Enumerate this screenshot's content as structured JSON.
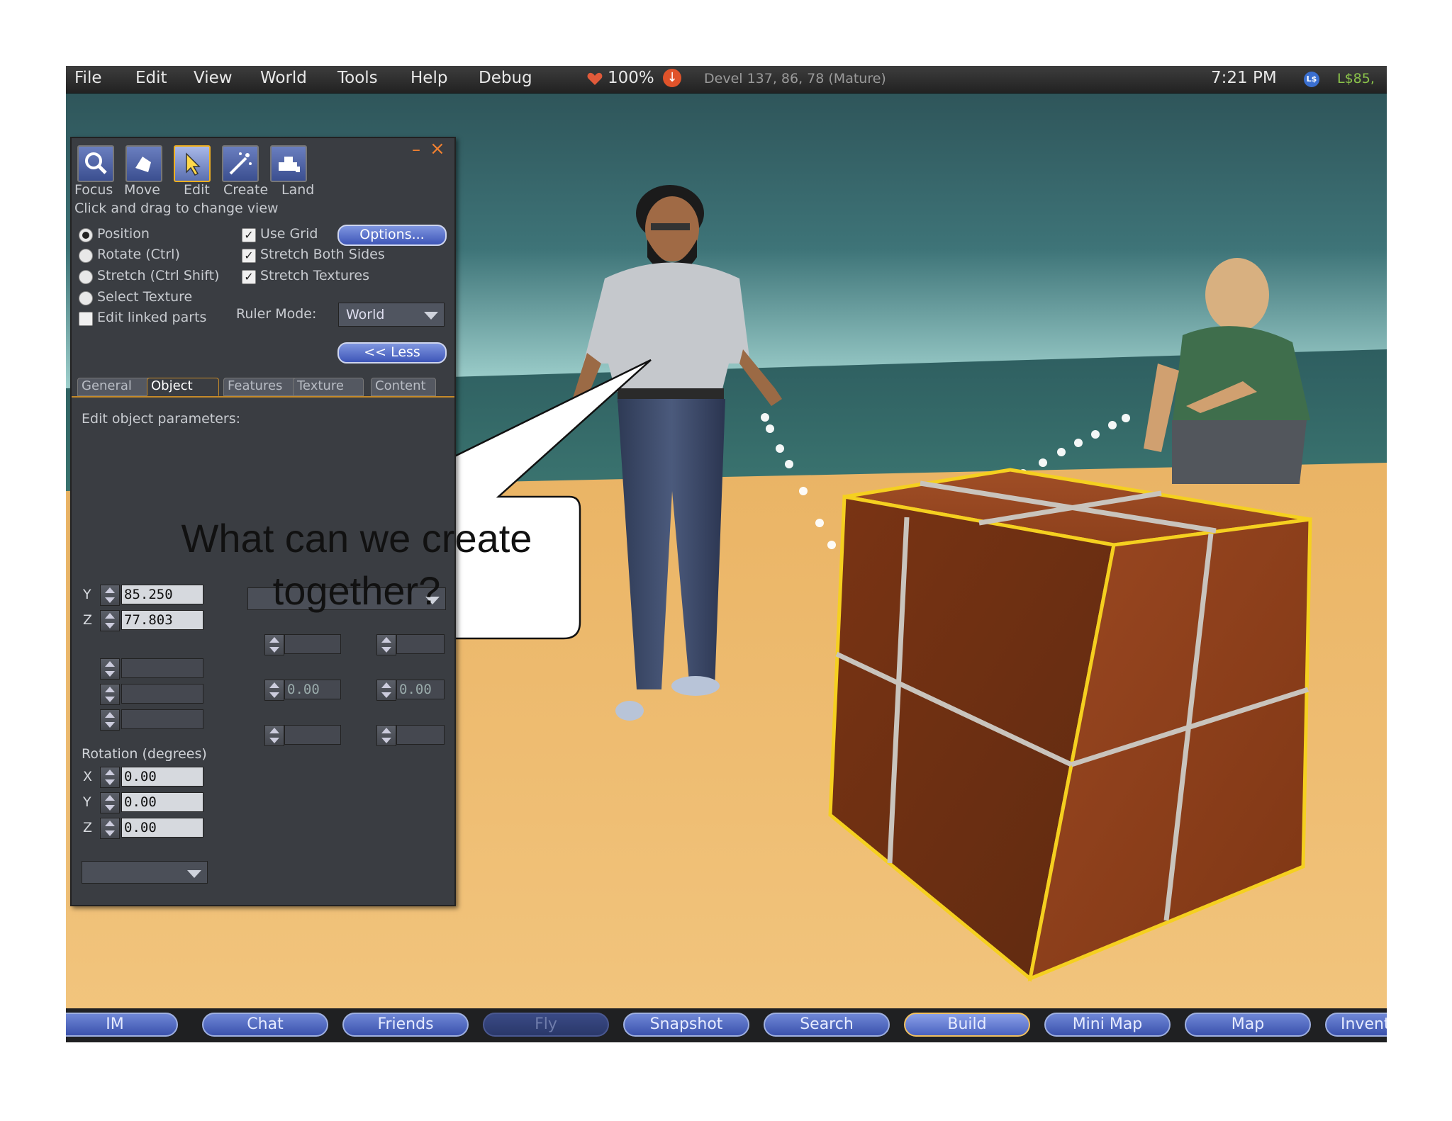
{
  "menu": {
    "items": [
      "File",
      "Edit",
      "View",
      "World",
      "Tools",
      "Help",
      "Debug"
    ],
    "health": "100%",
    "location": "Devel 137, 86, 78 (Mature)",
    "clock": "7:21 PM",
    "balance": "L$85,"
  },
  "build_panel": {
    "tools": [
      {
        "label": "Focus",
        "icon": "focus-icon"
      },
      {
        "label": "Move",
        "icon": "move-icon"
      },
      {
        "label": "Edit",
        "icon": "edit-icon",
        "active": true
      },
      {
        "label": "Create",
        "icon": "create-icon"
      },
      {
        "label": "Land",
        "icon": "land-icon"
      }
    ],
    "hint": "Click and drag to change view",
    "modes": [
      "Position",
      "Rotate (Ctrl)",
      "Stretch (Ctrl Shift)",
      "Select Texture"
    ],
    "selected_mode": "Position",
    "edit_linked": "Edit linked parts",
    "checks": [
      "Use Grid",
      "Stretch Both Sides",
      "Stretch Textures"
    ],
    "options_button": "Options...",
    "ruler_mode_label": "Ruler Mode:",
    "ruler_mode_value": "World",
    "less_button": "<< Less",
    "tabs": [
      "General",
      "Object",
      "Features",
      "Texture",
      "Content"
    ],
    "active_tab": "Object",
    "edit_params": "Edit object parameters:",
    "position": {
      "y": "85.250",
      "z": "77.803"
    },
    "rotation_label": "Rotation (degrees)",
    "rotation": {
      "x": "0.00",
      "y": "0.00",
      "z": "0.00"
    },
    "taper": {
      "x": "0.00",
      "y": "0.00"
    }
  },
  "callout": {
    "line1": "What can we create",
    "line2": "together?"
  },
  "toolbar": {
    "buttons": [
      {
        "label": "IM"
      },
      {
        "label": "Chat"
      },
      {
        "label": "Friends"
      },
      {
        "label": "Fly",
        "disabled": true
      },
      {
        "label": "Snapshot"
      },
      {
        "label": "Search"
      },
      {
        "label": "Build",
        "active": true
      },
      {
        "label": "Mini Map"
      },
      {
        "label": "Map"
      },
      {
        "label": "Inventory"
      }
    ]
  },
  "colors": {
    "sky_top": "#2d5358",
    "sky_horizon": "#8fc6c6",
    "ground": "#e8b060",
    "cube": "#9a4a22",
    "selection": "#f5d020",
    "panel": "#3a3d42",
    "toolbar_button": "#4e66c2"
  }
}
